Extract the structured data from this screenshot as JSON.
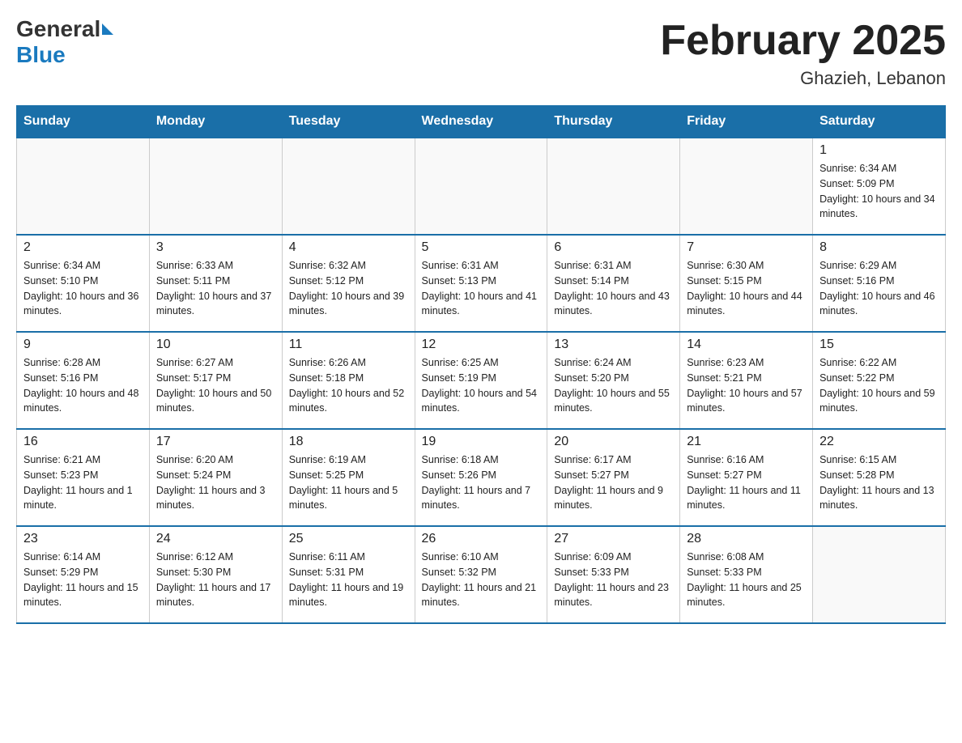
{
  "header": {
    "logo_general": "General",
    "logo_blue": "Blue",
    "month_title": "February 2025",
    "location": "Ghazieh, Lebanon"
  },
  "days_of_week": [
    "Sunday",
    "Monday",
    "Tuesday",
    "Wednesday",
    "Thursday",
    "Friday",
    "Saturday"
  ],
  "weeks": [
    [
      {
        "day": "",
        "info": ""
      },
      {
        "day": "",
        "info": ""
      },
      {
        "day": "",
        "info": ""
      },
      {
        "day": "",
        "info": ""
      },
      {
        "day": "",
        "info": ""
      },
      {
        "day": "",
        "info": ""
      },
      {
        "day": "1",
        "info": "Sunrise: 6:34 AM\nSunset: 5:09 PM\nDaylight: 10 hours and 34 minutes."
      }
    ],
    [
      {
        "day": "2",
        "info": "Sunrise: 6:34 AM\nSunset: 5:10 PM\nDaylight: 10 hours and 36 minutes."
      },
      {
        "day": "3",
        "info": "Sunrise: 6:33 AM\nSunset: 5:11 PM\nDaylight: 10 hours and 37 minutes."
      },
      {
        "day": "4",
        "info": "Sunrise: 6:32 AM\nSunset: 5:12 PM\nDaylight: 10 hours and 39 minutes."
      },
      {
        "day": "5",
        "info": "Sunrise: 6:31 AM\nSunset: 5:13 PM\nDaylight: 10 hours and 41 minutes."
      },
      {
        "day": "6",
        "info": "Sunrise: 6:31 AM\nSunset: 5:14 PM\nDaylight: 10 hours and 43 minutes."
      },
      {
        "day": "7",
        "info": "Sunrise: 6:30 AM\nSunset: 5:15 PM\nDaylight: 10 hours and 44 minutes."
      },
      {
        "day": "8",
        "info": "Sunrise: 6:29 AM\nSunset: 5:16 PM\nDaylight: 10 hours and 46 minutes."
      }
    ],
    [
      {
        "day": "9",
        "info": "Sunrise: 6:28 AM\nSunset: 5:16 PM\nDaylight: 10 hours and 48 minutes."
      },
      {
        "day": "10",
        "info": "Sunrise: 6:27 AM\nSunset: 5:17 PM\nDaylight: 10 hours and 50 minutes."
      },
      {
        "day": "11",
        "info": "Sunrise: 6:26 AM\nSunset: 5:18 PM\nDaylight: 10 hours and 52 minutes."
      },
      {
        "day": "12",
        "info": "Sunrise: 6:25 AM\nSunset: 5:19 PM\nDaylight: 10 hours and 54 minutes."
      },
      {
        "day": "13",
        "info": "Sunrise: 6:24 AM\nSunset: 5:20 PM\nDaylight: 10 hours and 55 minutes."
      },
      {
        "day": "14",
        "info": "Sunrise: 6:23 AM\nSunset: 5:21 PM\nDaylight: 10 hours and 57 minutes."
      },
      {
        "day": "15",
        "info": "Sunrise: 6:22 AM\nSunset: 5:22 PM\nDaylight: 10 hours and 59 minutes."
      }
    ],
    [
      {
        "day": "16",
        "info": "Sunrise: 6:21 AM\nSunset: 5:23 PM\nDaylight: 11 hours and 1 minute."
      },
      {
        "day": "17",
        "info": "Sunrise: 6:20 AM\nSunset: 5:24 PM\nDaylight: 11 hours and 3 minutes."
      },
      {
        "day": "18",
        "info": "Sunrise: 6:19 AM\nSunset: 5:25 PM\nDaylight: 11 hours and 5 minutes."
      },
      {
        "day": "19",
        "info": "Sunrise: 6:18 AM\nSunset: 5:26 PM\nDaylight: 11 hours and 7 minutes."
      },
      {
        "day": "20",
        "info": "Sunrise: 6:17 AM\nSunset: 5:27 PM\nDaylight: 11 hours and 9 minutes."
      },
      {
        "day": "21",
        "info": "Sunrise: 6:16 AM\nSunset: 5:27 PM\nDaylight: 11 hours and 11 minutes."
      },
      {
        "day": "22",
        "info": "Sunrise: 6:15 AM\nSunset: 5:28 PM\nDaylight: 11 hours and 13 minutes."
      }
    ],
    [
      {
        "day": "23",
        "info": "Sunrise: 6:14 AM\nSunset: 5:29 PM\nDaylight: 11 hours and 15 minutes."
      },
      {
        "day": "24",
        "info": "Sunrise: 6:12 AM\nSunset: 5:30 PM\nDaylight: 11 hours and 17 minutes."
      },
      {
        "day": "25",
        "info": "Sunrise: 6:11 AM\nSunset: 5:31 PM\nDaylight: 11 hours and 19 minutes."
      },
      {
        "day": "26",
        "info": "Sunrise: 6:10 AM\nSunset: 5:32 PM\nDaylight: 11 hours and 21 minutes."
      },
      {
        "day": "27",
        "info": "Sunrise: 6:09 AM\nSunset: 5:33 PM\nDaylight: 11 hours and 23 minutes."
      },
      {
        "day": "28",
        "info": "Sunrise: 6:08 AM\nSunset: 5:33 PM\nDaylight: 11 hours and 25 minutes."
      },
      {
        "day": "",
        "info": ""
      }
    ]
  ]
}
